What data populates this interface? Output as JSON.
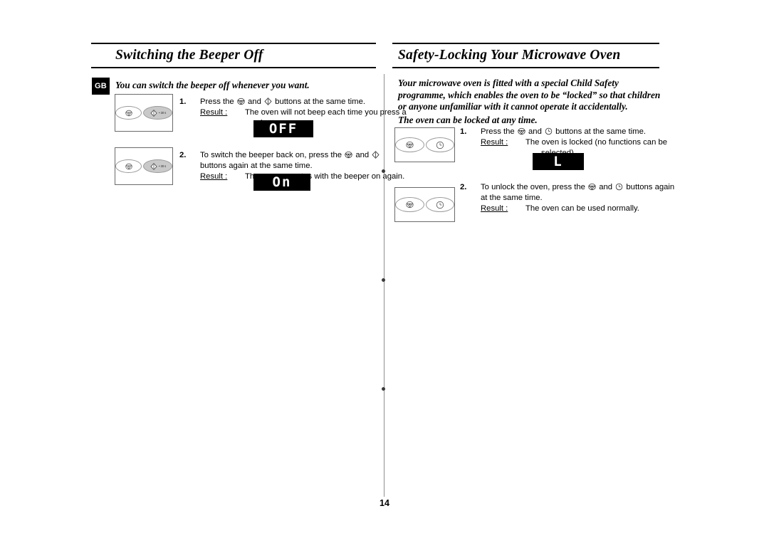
{
  "document": {
    "page_number": "14",
    "locale_badge": "GB"
  },
  "left_section": {
    "heading": "Switching the Beeper Off",
    "intro": "You can switch the beeper off whenever you want.",
    "steps": [
      {
        "number": "1.",
        "line1_a": "Press the",
        "icon1": "microwave-power-icon",
        "line1_b": "and",
        "icon2": "power-level-icon",
        "line1_c": "buttons at the same time.",
        "result_label": "Result :",
        "result_text": "The oven will not beep each time you press a",
        "result_text_cont": "button.",
        "display_value": "OFF",
        "panel": {
          "button_left": "microwave-power-icon",
          "button_right": "power-level-icon",
          "button_right_label": "• 30 s"
        }
      },
      {
        "number": "2.",
        "line1_a": "To switch the beeper back on, press the",
        "icon1": "microwave-power-icon",
        "line1_b": "and",
        "icon2": "power-level-icon",
        "line2": "buttons again at the same time.",
        "result_label": "Result :",
        "result_text": "The oven operates with the beeper on again.",
        "display_value": "On",
        "panel": {
          "button_left": "microwave-power-icon",
          "button_right": "power-level-icon",
          "button_right_label": "• 30 s"
        }
      }
    ]
  },
  "right_section": {
    "heading": "Safety-Locking Your Microwave Oven",
    "intro_1": "Your microwave oven is fitted with a special Child Safety programme, which enables the oven to be “locked” so that children or anyone unfamiliar with it cannot operate it accidentally.",
    "intro_2": "The oven can be locked at any time.",
    "steps": [
      {
        "number": "1.",
        "line1_a": "Press the",
        "icon1": "microwave-power-icon",
        "line1_b": "and",
        "icon2": "clock-icon",
        "line1_c": "buttons at the same time.",
        "result_label": "Result :",
        "result_text": "The oven is locked (no functions can be",
        "result_text_cont": "selected).",
        "display_value": "L",
        "panel": {
          "button_left": "microwave-power-icon",
          "button_right": "clock-icon"
        }
      },
      {
        "number": "2.",
        "line1_a": "To unlock the oven, press the",
        "icon1": "microwave-power-icon",
        "line1_b": "and",
        "icon2": "clock-icon",
        "line1_c": "buttons again",
        "line2": "at the same time.",
        "result_label": "Result :",
        "result_text": "The oven can be used normally.",
        "panel": {
          "button_left": "microwave-power-icon",
          "button_right": "clock-icon"
        }
      }
    ]
  },
  "colors": {
    "ink": "#000000",
    "paper": "#ffffff",
    "rule": "#000000",
    "divider": "#8f8f8f",
    "panel_border": "#6a6a6a",
    "button_gray": "#c9c9c9"
  }
}
